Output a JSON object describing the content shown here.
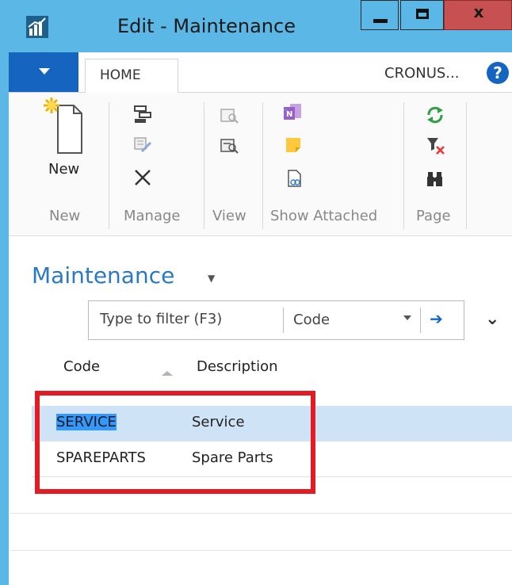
{
  "window": {
    "title": "Edit - Maintenance",
    "close_glyph": "x"
  },
  "ribbon_tabs": {
    "home_label": "HOME",
    "company": "CRONUS...",
    "help_glyph": "?"
  },
  "ribbon": {
    "new_button_label": "New",
    "groups": [
      "New",
      "Manage",
      "View",
      "Show Attached",
      "Page"
    ]
  },
  "page": {
    "title": "Maintenance"
  },
  "filter": {
    "placeholder": "Type to filter (F3)",
    "field": "Code"
  },
  "columns": [
    "Code",
    "Description"
  ],
  "rows": [
    {
      "code": "SERVICE",
      "description": "Service",
      "selected": true
    },
    {
      "code": "SPAREPARTS",
      "description": "Spare Parts",
      "selected": false
    }
  ],
  "colors": {
    "title_bar": "#5bb8e6",
    "accent": "#1565c0",
    "page_title": "#2b79c2",
    "selection": "#cfe3f6",
    "callout": "#e31c23"
  }
}
